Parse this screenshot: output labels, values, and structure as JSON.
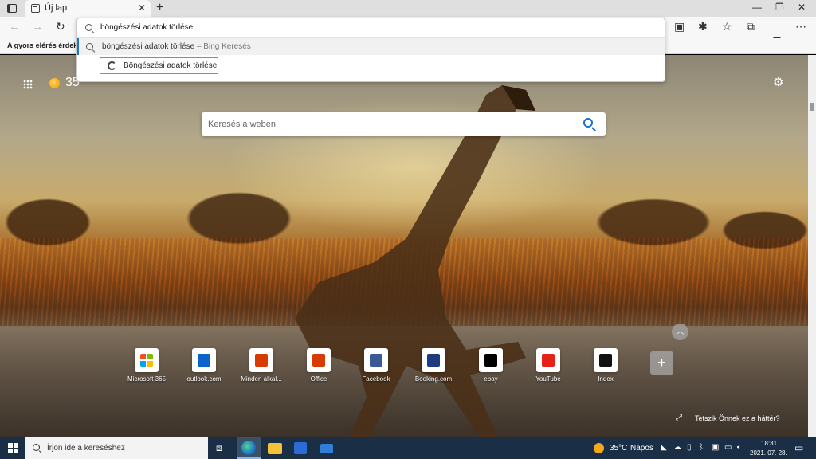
{
  "browser": {
    "tab": {
      "title": "Új lap"
    },
    "favorites_bar": {
      "text": "A gyors elérés érdekébe"
    },
    "omnibox": {
      "typed_text": "böngészési adatok törlése",
      "suggestion": {
        "text": "böngészési adatok törlése",
        "source": " – Bing Keresés"
      },
      "action_button": "Böngészési adatok törlése"
    }
  },
  "newtab": {
    "weather": {
      "temp": "35",
      "unit": "C"
    },
    "search": {
      "placeholder": "Keresés a weben"
    },
    "quick_links": [
      {
        "label": "Microsoft 365",
        "icon": "microsoft-365-icon",
        "color": "#ffffff"
      },
      {
        "label": "outlook.com",
        "icon": "outlook-icon",
        "color": "#0a64c9"
      },
      {
        "label": "Minden alkal...",
        "icon": "office-apps-icon",
        "color": "#d83b01"
      },
      {
        "label": "Office",
        "icon": "office-icon",
        "color": "#d83b01"
      },
      {
        "label": "Facebook",
        "icon": "facebook-icon",
        "color": "#3b5998"
      },
      {
        "label": "Booking.com",
        "icon": "booking-icon",
        "color": "#1c3b80"
      },
      {
        "label": "ebay",
        "icon": "ebay-icon",
        "color": "#000000"
      },
      {
        "label": "YouTube",
        "icon": "youtube-icon",
        "color": "#e62117"
      },
      {
        "label": "Index",
        "icon": "index-icon",
        "color": "#111111"
      }
    ],
    "background_feedback": "Tetszik Önnek ez a háttér?"
  },
  "taskbar": {
    "search_placeholder": "Írjon ide a kereséshez",
    "weather_temp": "35°C",
    "weather_condition": "Napos",
    "time": "18:31",
    "date": "2021. 07. 28."
  }
}
